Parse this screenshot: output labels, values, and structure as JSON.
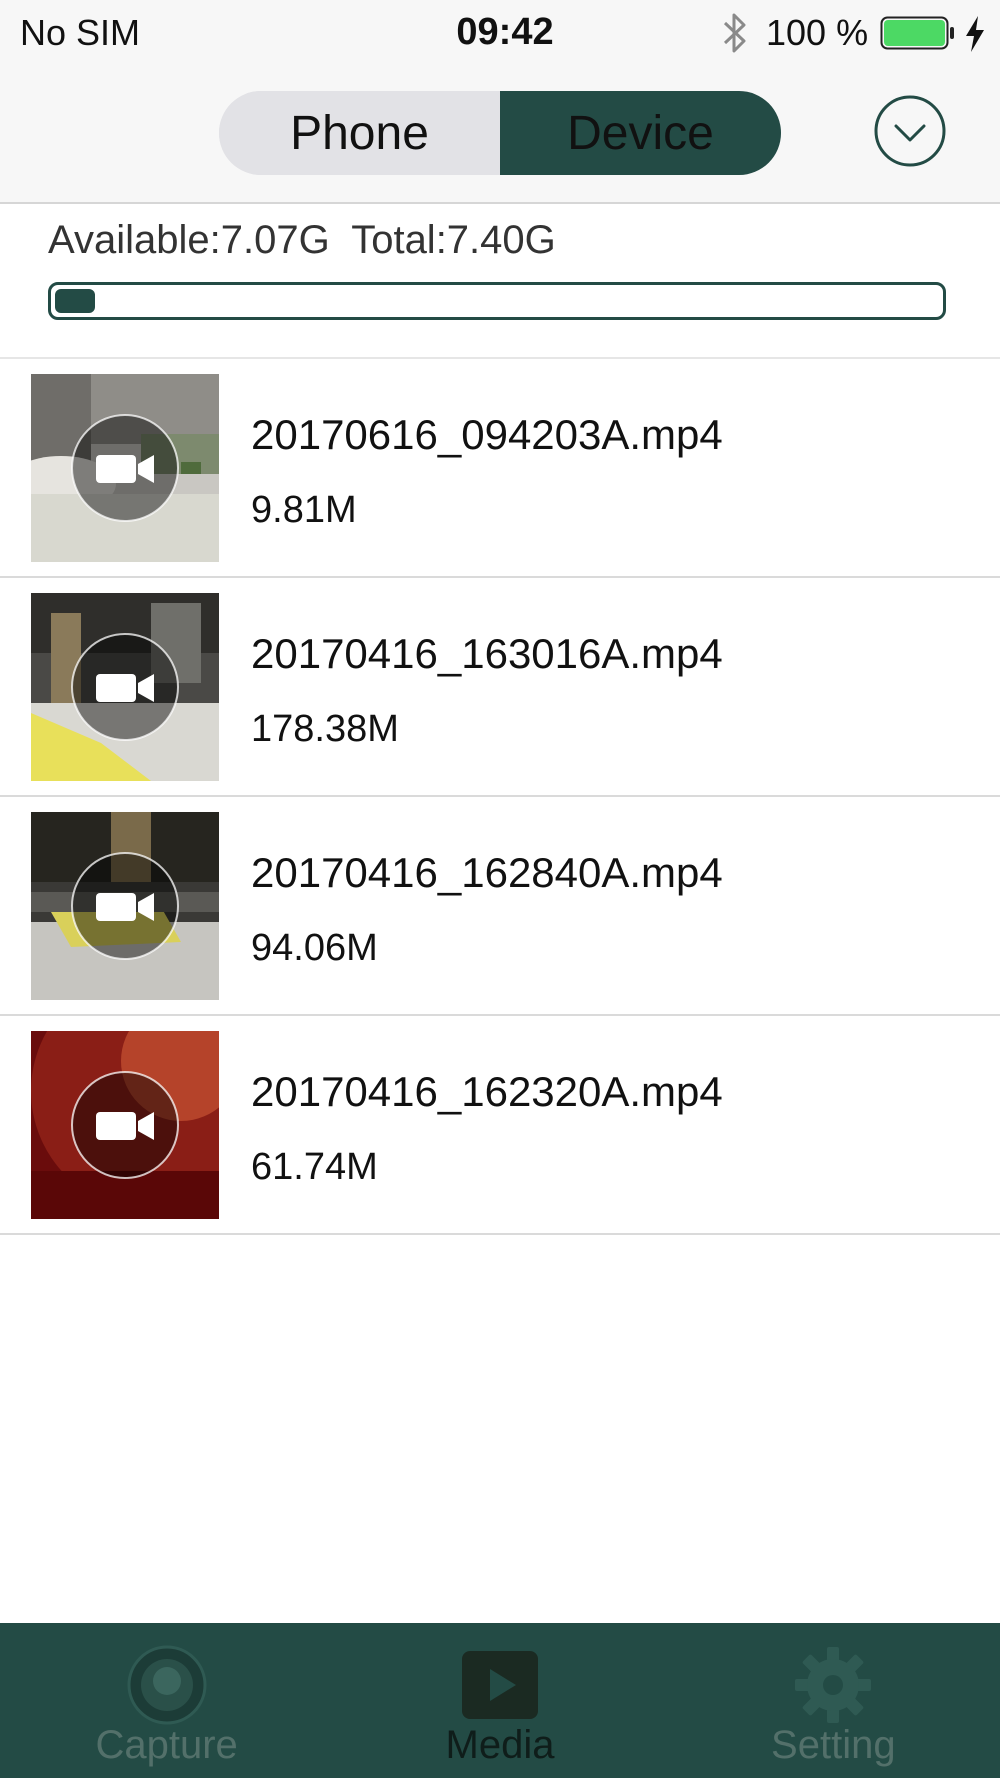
{
  "status_bar": {
    "carrier": "No SIM",
    "time": "09:42",
    "battery_text": "100 %",
    "battery_level": 1.0,
    "icons": [
      "bluetooth-icon",
      "battery-icon",
      "charging-icon"
    ]
  },
  "header": {
    "segments": [
      "Phone",
      "Device"
    ],
    "selected_segment": "Device",
    "dropdown_icon": "chevron-down-circle-icon"
  },
  "storage": {
    "available_label": "Available:7.07G",
    "total_label": "Total:7.40G",
    "used_fraction": 0.045
  },
  "files": [
    {
      "name": "20170616_094203A.mp4",
      "size": "9.81M",
      "icon": "video-camera-icon"
    },
    {
      "name": "20170416_163016A.mp4",
      "size": "178.38M",
      "icon": "video-camera-icon"
    },
    {
      "name": "20170416_162840A.mp4",
      "size": "94.06M",
      "icon": "video-camera-icon"
    },
    {
      "name": "20170416_162320A.mp4",
      "size": "61.74M",
      "icon": "video-camera-icon"
    }
  ],
  "tab_bar": {
    "tabs": [
      {
        "label": "Capture",
        "icon": "camera-lens-icon"
      },
      {
        "label": "Media",
        "icon": "play-icon"
      },
      {
        "label": "Setting",
        "icon": "gear-icon"
      }
    ],
    "selected_tab": "Media"
  },
  "colors": {
    "accent": "#234b45",
    "battery": "#4cd964",
    "tab_inactive": "#53706a",
    "tab_active": "#0f1d1a"
  }
}
